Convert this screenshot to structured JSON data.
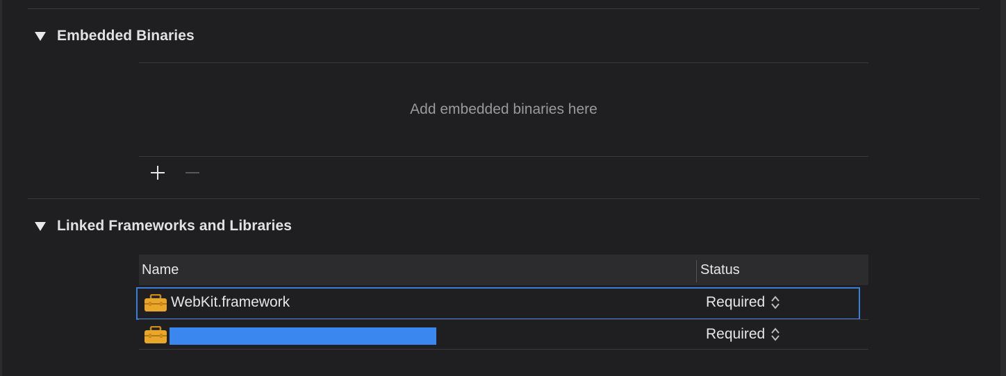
{
  "embedded_binaries": {
    "title": "Embedded Binaries",
    "placeholder": "Add embedded binaries here",
    "add_icon": "plus-icon",
    "remove_icon": "minus-icon"
  },
  "linked_frameworks": {
    "title": "Linked Frameworks and Libraries",
    "columns": {
      "name": "Name",
      "status": "Status"
    },
    "rows": [
      {
        "name": "WebKit.framework",
        "status": "Required",
        "icon": "toolbox-icon",
        "selected": true
      },
      {
        "name": "",
        "status": "Required",
        "icon": "toolbox-icon",
        "redacted": true
      }
    ]
  },
  "colors": {
    "background": "#1f1f21",
    "selection_outline": "#3d7ed8",
    "redaction": "#3b87f0",
    "toolbox": "#e8a62a"
  }
}
